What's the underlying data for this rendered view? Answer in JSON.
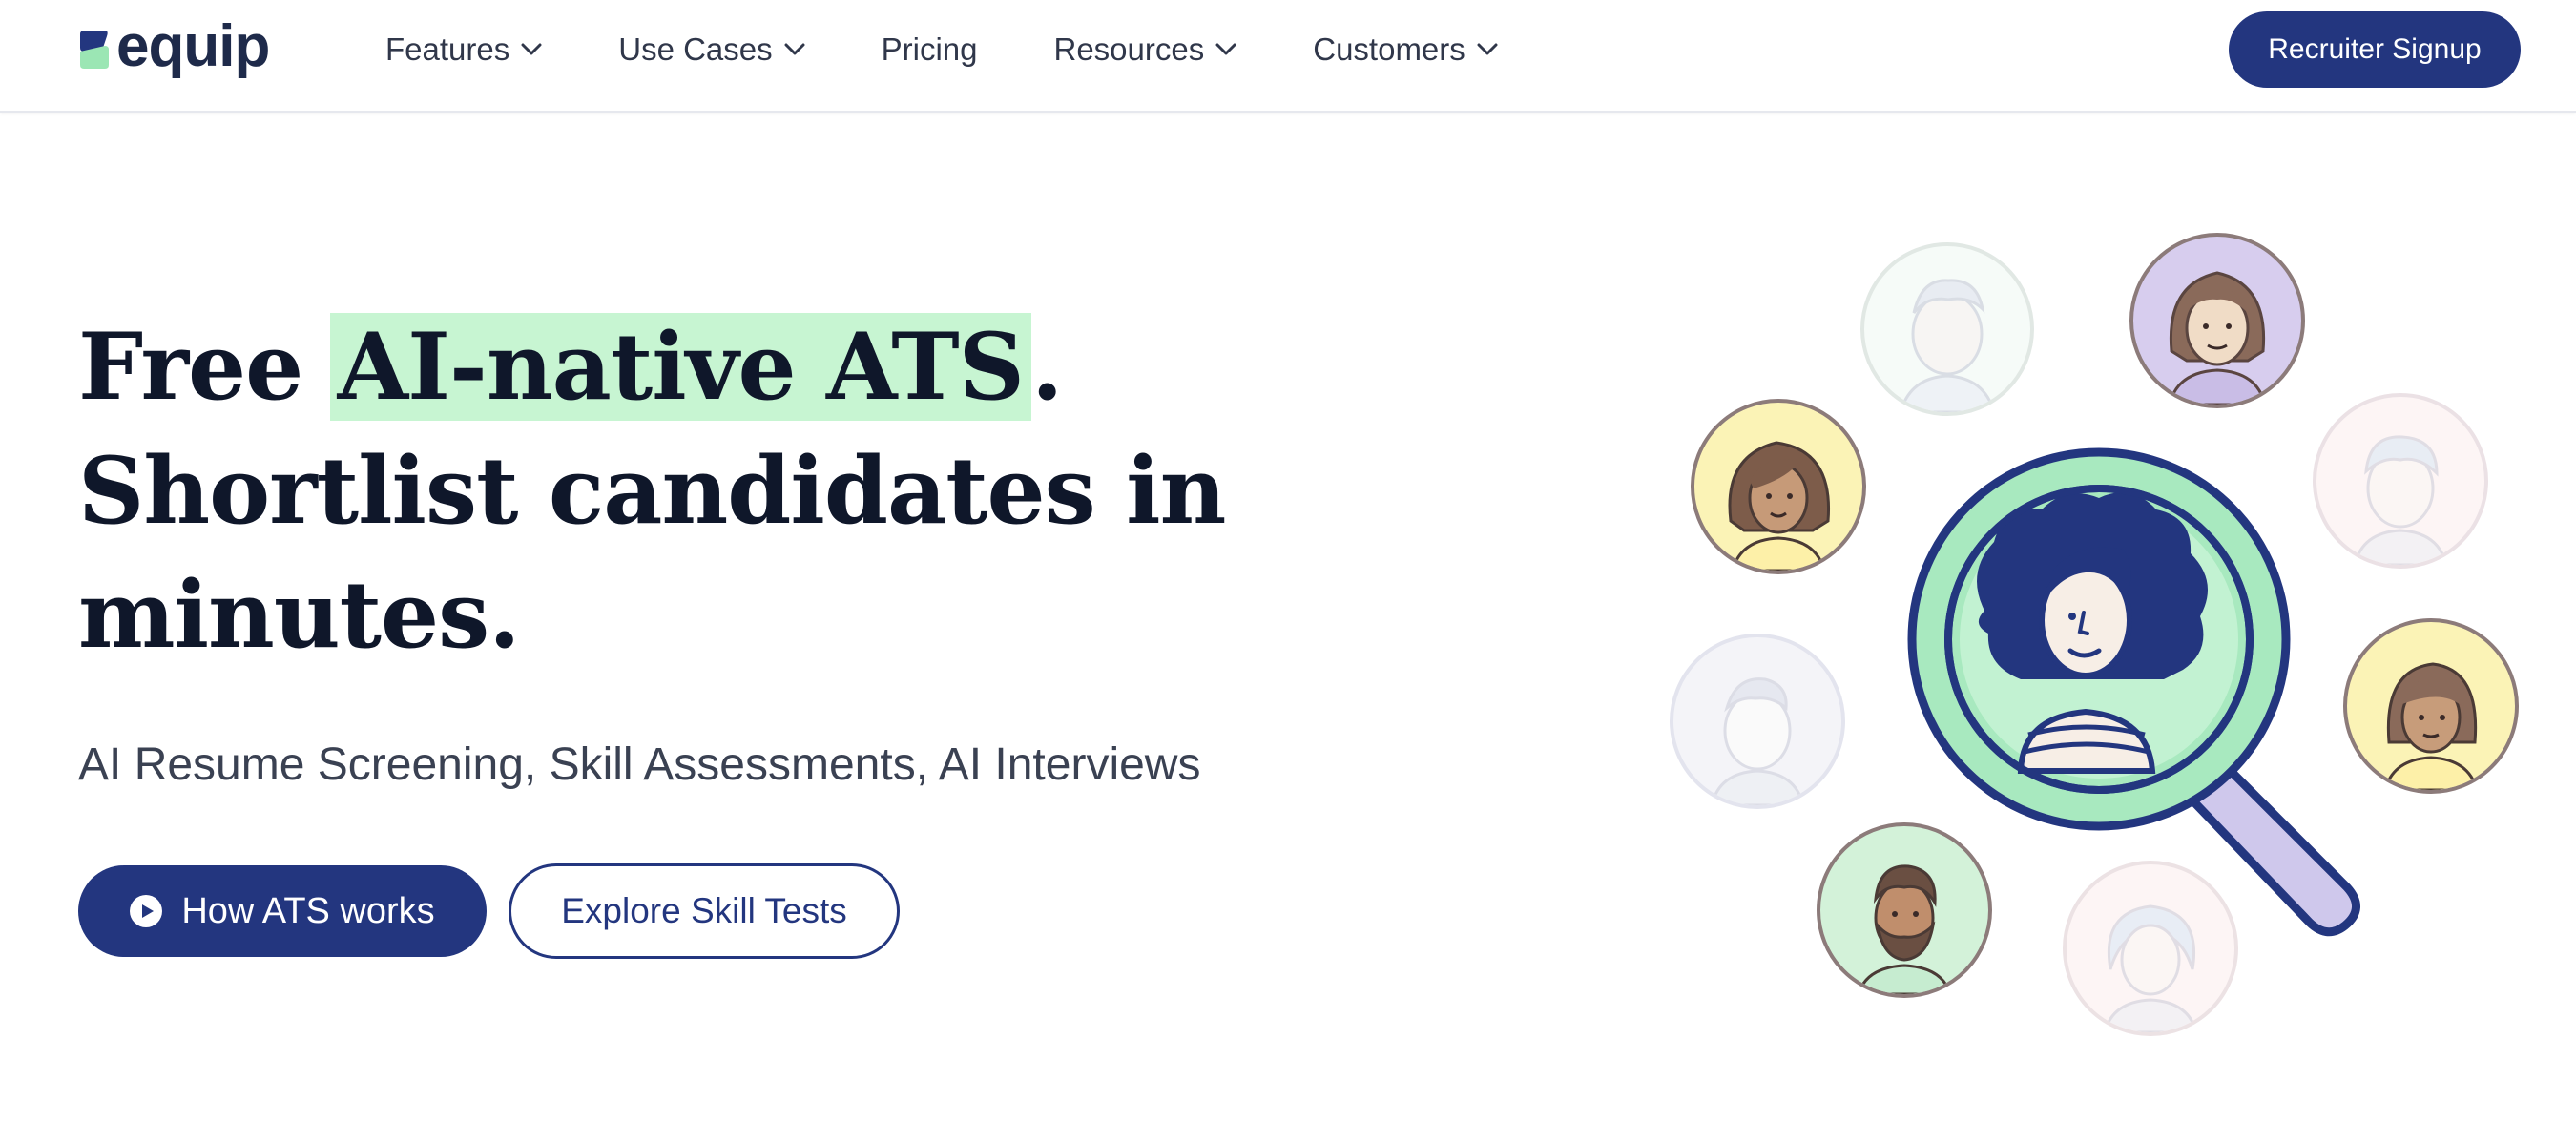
{
  "brand": {
    "name": "equip"
  },
  "nav": {
    "items": [
      {
        "label": "Features",
        "has_dropdown": true
      },
      {
        "label": "Use Cases",
        "has_dropdown": true
      },
      {
        "label": "Pricing",
        "has_dropdown": false
      },
      {
        "label": "Resources",
        "has_dropdown": true
      },
      {
        "label": "Customers",
        "has_dropdown": true
      }
    ],
    "signup_label": "Recruiter Signup"
  },
  "hero": {
    "title_prefix": "Free ",
    "title_highlight": "AI-native ATS",
    "title_suffix": ".",
    "title_line2": "Shortlist candidates in",
    "title_line3": "minutes.",
    "subtitle": "AI Resume Screening, Skill Assessments, AI Interviews",
    "primary_cta": "How ATS works",
    "secondary_cta": "Explore Skill Tests"
  },
  "colors": {
    "brand": "#23367f",
    "highlight": "#c7f5d2",
    "text_dark": "#0f172a",
    "nav_text": "#30374a"
  },
  "icons": {
    "dropdown": "chevron-down-icon",
    "play": "play-circle-icon",
    "illustration": "magnifying-glass-candidate-search"
  }
}
